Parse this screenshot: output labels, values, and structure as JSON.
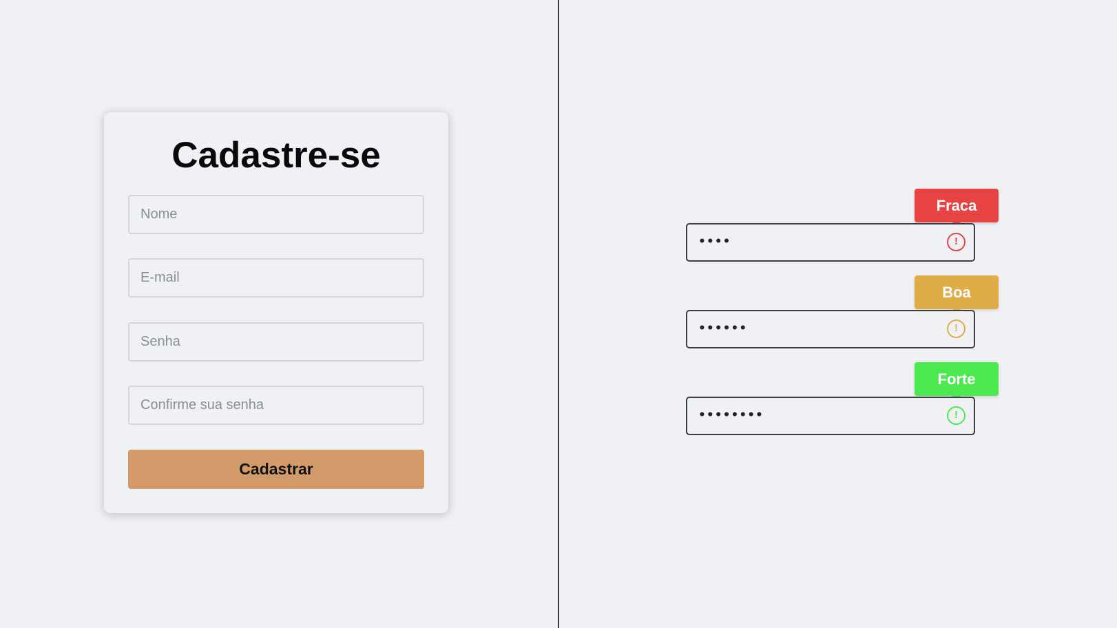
{
  "signup": {
    "title": "Cadastre-se",
    "fields": {
      "name_placeholder": "Nome",
      "email_placeholder": "E-mail",
      "password_placeholder": "Senha",
      "confirm_placeholder": "Confirme sua senha"
    },
    "submit_label": "Cadastrar",
    "submit_color": "#d49b6a"
  },
  "strength_demo": [
    {
      "label": "Fraca",
      "masked_value": "••••",
      "color": "#e84343",
      "icon": "alert-circle-icon"
    },
    {
      "label": "Boa",
      "masked_value": "••••••",
      "color": "#e0ac45",
      "icon": "alert-circle-icon"
    },
    {
      "label": "Forte",
      "masked_value": "••••••••",
      "color": "#4ce84f",
      "icon": "alert-circle-icon"
    }
  ]
}
